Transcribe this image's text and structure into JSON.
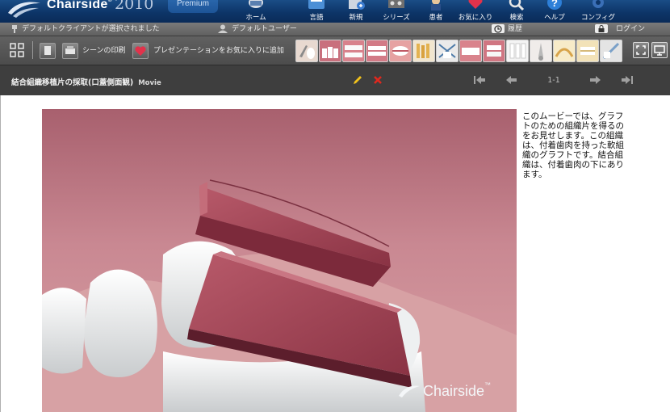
{
  "app": {
    "brand": "Chairside",
    "brand_mark": "®",
    "year": "2010",
    "edition": "Premium"
  },
  "nav": {
    "items": [
      {
        "label": "ホーム",
        "icon": "tooth-home-icon"
      },
      {
        "label": "言語",
        "icon": "language-icon"
      },
      {
        "label": "新規",
        "icon": "new-icon"
      },
      {
        "label": "シリーズ",
        "icon": "series-film-icon"
      },
      {
        "label": "患者",
        "icon": "patient-icon"
      },
      {
        "label": "お気に入り",
        "icon": "favorites-heart-icon"
      },
      {
        "label": "検索",
        "icon": "search-icon"
      },
      {
        "label": "ヘルプ",
        "icon": "help-icon"
      },
      {
        "label": "コンフィグ",
        "icon": "config-gear-icon"
      }
    ]
  },
  "status": {
    "client": "デフォルトクライアントが選択されました",
    "user": "デフォルトユーザー",
    "history": "履歴",
    "login": "ログイン"
  },
  "toolbar": {
    "print_label": "シーンの印刷",
    "add_favorite_label": "プレゼンテーションをお気に入りに追加",
    "thumbnails": 15
  },
  "scene": {
    "title": "結合組織移植片の採取(口蓋側面観)",
    "type": "Movie",
    "page": "1-1"
  },
  "content": {
    "description": "このムービーでは、グラフトのための組織片を得るのをお見せします。この組織は、付着歯肉を持った軟組織のグラフトです。結合組織は、付着歯肉の下にあります。",
    "watermark": "Chairside",
    "watermark_tm": "™"
  },
  "colors": {
    "banner": "#0d3568",
    "toolbar": "#555555",
    "titlebar": "#3e3e3e",
    "accent_edit": "#f2c21b",
    "accent_delete": "#e0281e"
  }
}
